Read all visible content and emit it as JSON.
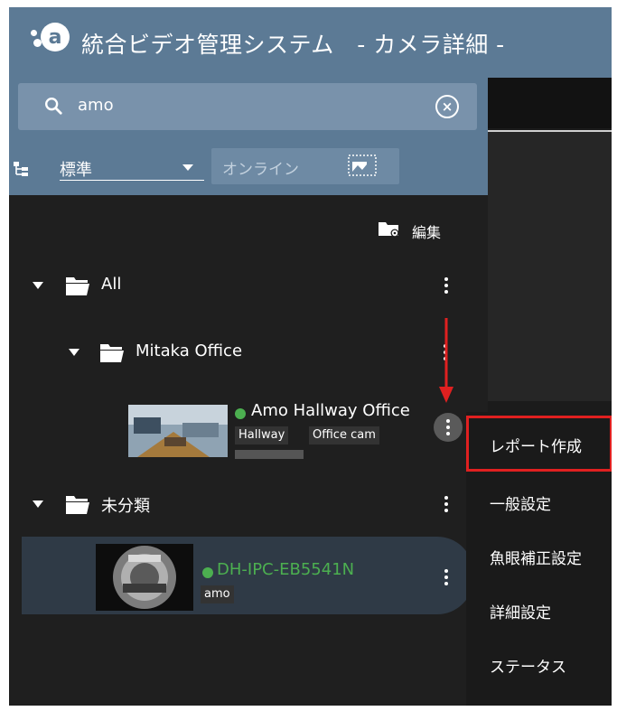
{
  "header": {
    "logo_letter": "a",
    "title": "統合ビデオ管理システム　- カメラ詳細 -"
  },
  "search": {
    "value": "amo",
    "icon": "search-icon",
    "clear_icon": "clear-icon"
  },
  "view_select": {
    "value": "標準"
  },
  "filter": {
    "online_label": "オンライン"
  },
  "tree": {
    "edit_label": "編集",
    "folders": [
      {
        "label": "All"
      },
      {
        "label": "Mitaka Office"
      },
      {
        "label": "未分類"
      }
    ],
    "cameras": [
      {
        "name": "Amo Hallway Office",
        "tags": [
          "Hallway",
          "Office cam"
        ],
        "status_color": "#4caf50"
      },
      {
        "name": "DH-IPC-EB5541N",
        "tags": [
          "amo"
        ],
        "status_color": "#4caf50",
        "name_color": "#4caf50"
      }
    ]
  },
  "context_menu": {
    "items": [
      {
        "label": "レポート作成"
      },
      {
        "label": "一般設定"
      },
      {
        "label": "魚眼補正設定"
      },
      {
        "label": "詳細設定"
      },
      {
        "label": "ステータス"
      }
    ],
    "highlight_color": "#e02020"
  },
  "colors": {
    "header_bg": "#5c7a95",
    "panel_bg": "#1f1f1f"
  }
}
